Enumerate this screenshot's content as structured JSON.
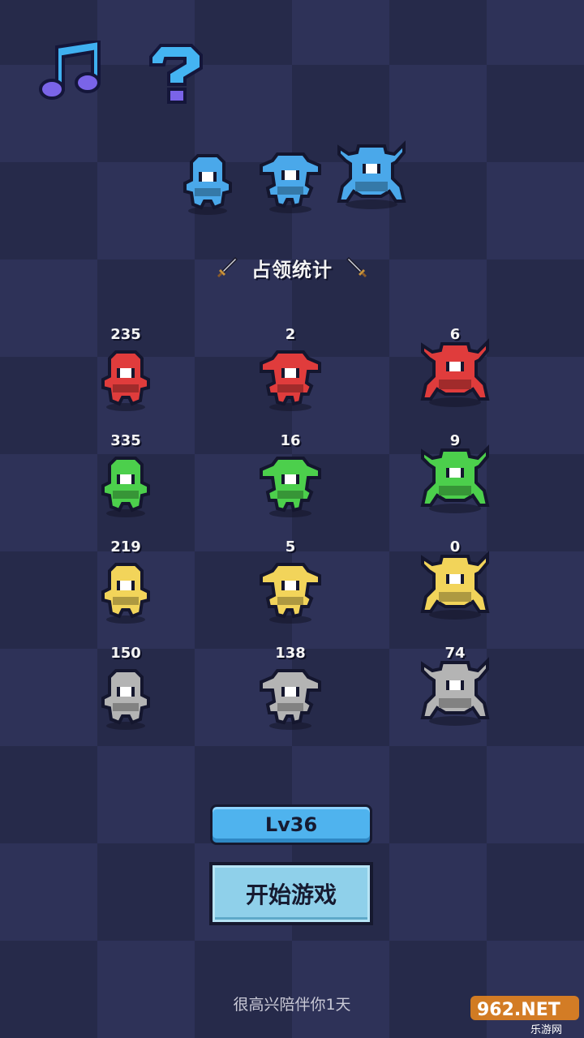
{
  "top_icons": {
    "music": "music-note-icon",
    "help": "question-mark-icon"
  },
  "stats_title": "占领统计",
  "colors": {
    "blue": "#4aa8ea",
    "red": "#e03c3c",
    "green": "#4ccf4c",
    "yellow": "#f2d45a",
    "gray": "#b4b4b4"
  },
  "stats": [
    {
      "color": "red",
      "counts": [
        "235",
        "2",
        "6"
      ]
    },
    {
      "color": "green",
      "counts": [
        "335",
        "16",
        "9"
      ]
    },
    {
      "color": "yellow",
      "counts": [
        "219",
        "5",
        "0"
      ]
    },
    {
      "color": "gray",
      "counts": [
        "150",
        "138",
        "74"
      ]
    }
  ],
  "level_label": "Lv36",
  "start_button": "开始游戏",
  "footer": "很高兴陪伴你1天",
  "watermark": {
    "top": "962.NET",
    "bottom": "乐游网"
  }
}
